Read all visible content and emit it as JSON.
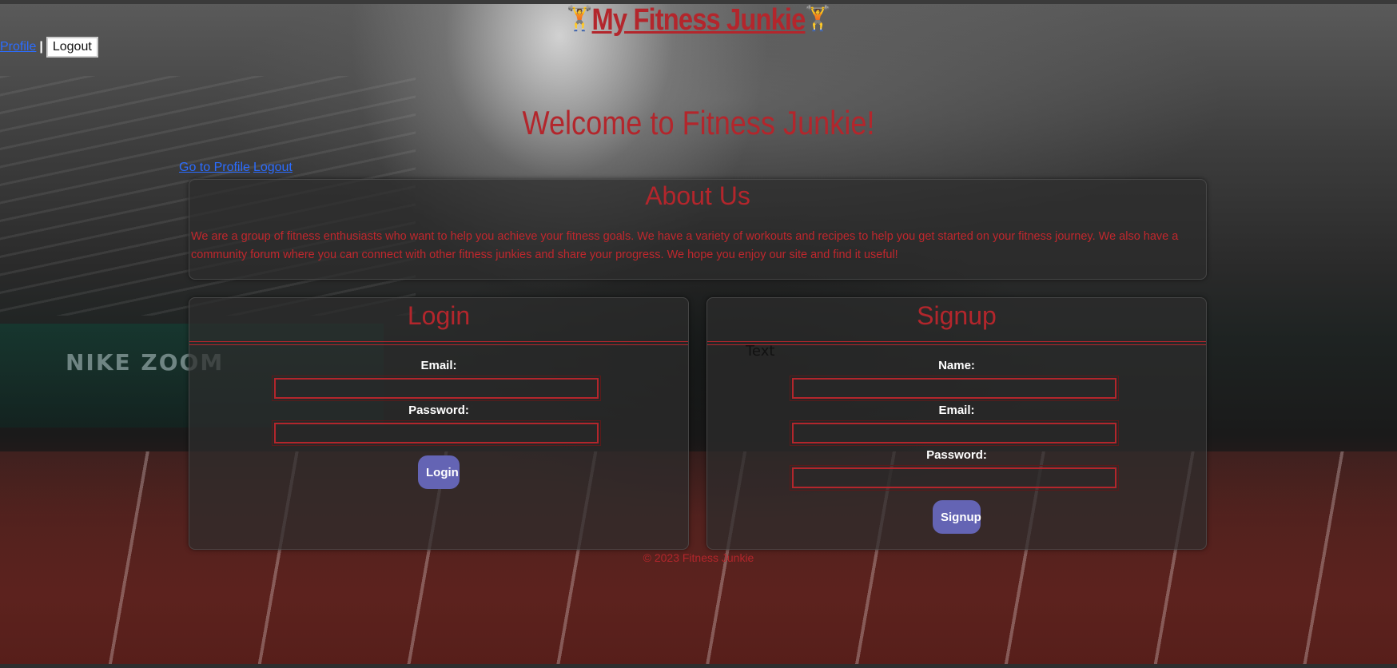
{
  "site": {
    "title": "My Fitness Junkie",
    "title_icon": "🏋️"
  },
  "nav": {
    "profile_link": "Profile",
    "separator": "|",
    "logout_button": "Logout"
  },
  "welcome": {
    "heading": "Welcome to Fitness Junkie!"
  },
  "quick_links": {
    "go_to_profile": "Go to Profile",
    "logout": "Logout"
  },
  "about": {
    "heading": "About Us",
    "body": "We are a group of fitness enthusiasts who want to help you achieve your fitness goals. We have a variety of workouts and recipes to help you get started on your fitness journey. We also have a community forum where you can connect with other fitness junkies and share your progress. We hope you enjoy our site and find it useful!"
  },
  "login": {
    "heading": "Login",
    "email_label": "Email:",
    "email_value": "",
    "password_label": "Password:",
    "password_value": "",
    "submit_label": "Login"
  },
  "signup": {
    "heading": "Signup",
    "stray_text": "Text",
    "name_label": "Name:",
    "name_value": "",
    "email_label": "Email:",
    "email_value": "",
    "password_label": "Password:",
    "password_value": "",
    "submit_label": "Signup"
  },
  "footer": {
    "copyright": "© 2023 Fitness Junkie"
  },
  "colors": {
    "accent_red": "#b3262c",
    "button_purple": "#6464b4",
    "link_blue": "#2b6cff"
  },
  "background": {
    "image": "Runners on stadium track, including wall text NIKE ZOOM",
    "wall_text": "NIKE ZOOM"
  }
}
